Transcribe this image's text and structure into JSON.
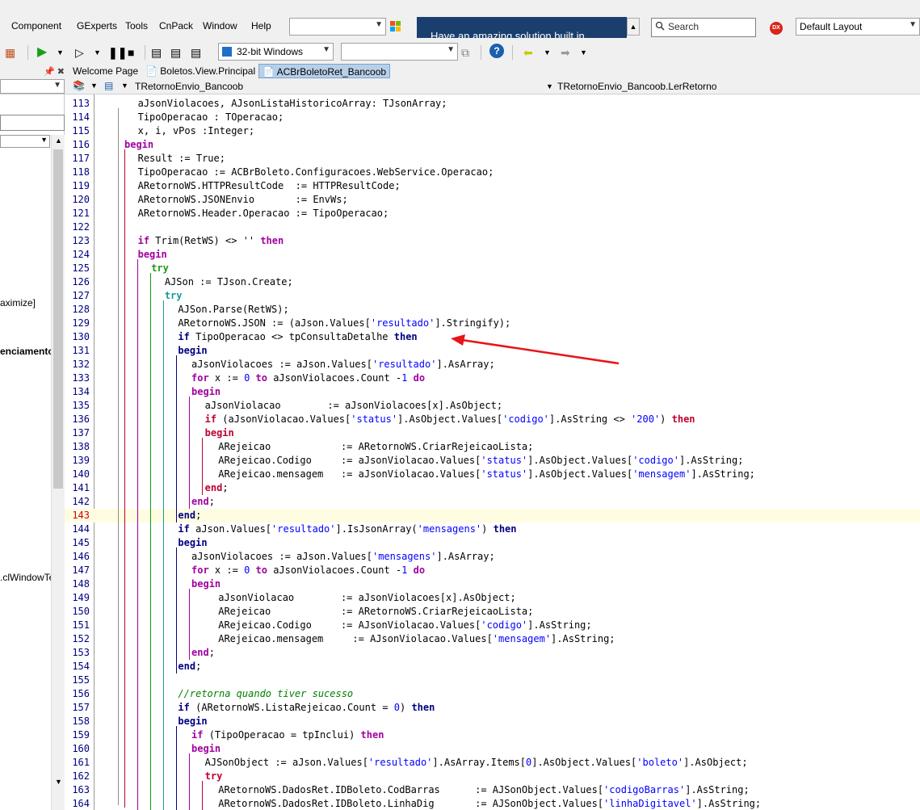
{
  "menu": {
    "items": [
      "Component",
      "GExperts",
      "Tools",
      "CnPack",
      "Window",
      "Help"
    ],
    "search_placeholder": "Search",
    "layout_value": "Default Layout",
    "ad_text": "Have an amazing solution built in",
    "dx_badge": "DX"
  },
  "toolbar": {
    "platform": "32-bit Windows"
  },
  "tabs": [
    {
      "label": "Welcome Page",
      "active": false
    },
    {
      "label": "Boletos.View.Principal",
      "active": false
    },
    {
      "label": "ACBrBoletoRet_Bancoob",
      "active": true
    }
  ],
  "editor": {
    "class_name": "TRetornoEnvio_Bancoob",
    "method_name": "TRetornoEnvio_Bancoob.LerRetorno",
    "current_line": 143
  },
  "left_panel": {
    "items": [
      {
        "text": "aximize]",
        "bold": false
      },
      {
        "text": "enciamento",
        "bold": true
      },
      {
        "text": ".clWindowTe",
        "bold": false
      }
    ]
  },
  "code_lines": [
    {
      "n": "113",
      "indent": 2,
      "parts": [
        [
          "t",
          "aJsonViolacoes, AJsonListaHistoricoArray: TJsonArray;"
        ]
      ]
    },
    {
      "n": "114",
      "indent": 2,
      "parts": [
        [
          "t",
          "TipoOperacao : TOperacao;"
        ]
      ]
    },
    {
      "n": "115",
      "indent": 2,
      "parts": [
        [
          "t",
          "x, i, vPos :Integer;"
        ]
      ]
    },
    {
      "n": "116",
      "indent": 0,
      "parts": [
        [
          "k2",
          "begin"
        ]
      ]
    },
    {
      "n": "117",
      "indent": 2,
      "parts": [
        [
          "t",
          "Result := True;"
        ]
      ]
    },
    {
      "n": "118",
      "indent": 2,
      "parts": [
        [
          "t",
          "TipoOperacao := ACBrBoleto.Configuracoes.WebService.Operacao;"
        ]
      ]
    },
    {
      "n": "119",
      "indent": 2,
      "parts": [
        [
          "t",
          "ARetornoWS.HTTPResultCode  := HTTPResultCode;"
        ]
      ]
    },
    {
      "n": "120",
      "indent": 2,
      "parts": [
        [
          "t",
          "ARetornoWS.JSONEnvio       := EnvWs;"
        ]
      ]
    },
    {
      "n": "121",
      "indent": 2,
      "parts": [
        [
          "t",
          "ARetornoWS.Header.Operacao := TipoOperacao;"
        ]
      ]
    },
    {
      "n": "122",
      "indent": 0,
      "parts": []
    },
    {
      "n": "123",
      "indent": 2,
      "parts": [
        [
          "k2",
          "if"
        ],
        [
          "t",
          " Trim(RetWS) <> '' "
        ],
        [
          "k2",
          "then"
        ]
      ]
    },
    {
      "n": "124",
      "indent": 2,
      "parts": [
        [
          "k2",
          "begin"
        ]
      ]
    },
    {
      "n": "125",
      "indent": 4,
      "parts": [
        [
          "k3",
          "try"
        ]
      ]
    },
    {
      "n": "126",
      "indent": 6,
      "parts": [
        [
          "t",
          "AJSon := TJson.Create;"
        ]
      ]
    },
    {
      "n": "127",
      "indent": 6,
      "parts": [
        [
          "k4",
          "try"
        ]
      ]
    },
    {
      "n": "128",
      "indent": 8,
      "parts": [
        [
          "t",
          "AJSon.Parse(RetWS);"
        ]
      ]
    },
    {
      "n": "129",
      "indent": 8,
      "parts": [
        [
          "t",
          "ARetornoWS.JSON := (aJson.Values["
        ],
        [
          "s",
          "'resultado'"
        ],
        [
          "t",
          "].Stringify);"
        ]
      ]
    },
    {
      "n": "130",
      "indent": 8,
      "parts": [
        [
          "kw",
          "if"
        ],
        [
          "t",
          " TipoOperacao <> tpConsultaDetalhe "
        ],
        [
          "kw",
          "then"
        ]
      ]
    },
    {
      "n": "131",
      "indent": 8,
      "parts": [
        [
          "kw",
          "begin"
        ]
      ]
    },
    {
      "n": "132",
      "indent": 10,
      "parts": [
        [
          "t",
          "aJsonViolacoes := aJson.Values["
        ],
        [
          "s",
          "'resultado'"
        ],
        [
          "t",
          "].AsArray;"
        ]
      ]
    },
    {
      "n": "133",
      "indent": 10,
      "parts": [
        [
          "k2",
          "for"
        ],
        [
          "t",
          " x := "
        ],
        [
          "s",
          "0"
        ],
        [
          "t",
          " "
        ],
        [
          "k2",
          "to"
        ],
        [
          "t",
          " aJsonViolacoes.Count -"
        ],
        [
          "s",
          "1"
        ],
        [
          "t",
          " "
        ],
        [
          "k2",
          "do"
        ]
      ]
    },
    {
      "n": "134",
      "indent": 10,
      "parts": [
        [
          "k2",
          "begin"
        ]
      ]
    },
    {
      "n": "135",
      "indent": 12,
      "parts": [
        [
          "t",
          "aJsonViolacao        := aJsonViolacoes[x].AsObject;"
        ]
      ]
    },
    {
      "n": "136",
      "indent": 12,
      "parts": [
        [
          "k5",
          "if"
        ],
        [
          "t",
          " (aJsonViolacao.Values["
        ],
        [
          "s",
          "'status'"
        ],
        [
          "t",
          "].AsObject.Values["
        ],
        [
          "s",
          "'codigo'"
        ],
        [
          "t",
          "].AsString <> "
        ],
        [
          "s",
          "'200'"
        ],
        [
          "t",
          ") "
        ],
        [
          "k5",
          "then"
        ]
      ]
    },
    {
      "n": "137",
      "indent": 12,
      "parts": [
        [
          "k5",
          "begin"
        ]
      ]
    },
    {
      "n": "138",
      "indent": 14,
      "parts": [
        [
          "t",
          "ARejeicao            := ARetornoWS.CriarRejeicaoLista;"
        ]
      ]
    },
    {
      "n": "139",
      "indent": 14,
      "parts": [
        [
          "t",
          "ARejeicao.Codigo     := aJsonViolacao.Values["
        ],
        [
          "s",
          "'status'"
        ],
        [
          "t",
          "].AsObject.Values["
        ],
        [
          "s",
          "'codigo'"
        ],
        [
          "t",
          "].AsString;"
        ]
      ]
    },
    {
      "n": "140",
      "indent": 14,
      "parts": [
        [
          "t",
          "ARejeicao.mensagem   := aJsonViolacao.Values["
        ],
        [
          "s",
          "'status'"
        ],
        [
          "t",
          "].AsObject.Values["
        ],
        [
          "s",
          "'mensagem'"
        ],
        [
          "t",
          "].AsString;"
        ]
      ]
    },
    {
      "n": "141",
      "indent": 12,
      "parts": [
        [
          "k5",
          "end"
        ],
        [
          "t",
          ";"
        ]
      ]
    },
    {
      "n": "142",
      "indent": 10,
      "parts": [
        [
          "k2",
          "end"
        ],
        [
          "t",
          ";"
        ]
      ]
    },
    {
      "n": "143",
      "indent": 8,
      "parts": [
        [
          "kw",
          "end"
        ],
        [
          "t",
          ";"
        ]
      ]
    },
    {
      "n": "144",
      "indent": 8,
      "parts": [
        [
          "kw",
          "if"
        ],
        [
          "t",
          " aJson.Values["
        ],
        [
          "s",
          "'resultado'"
        ],
        [
          "t",
          "].IsJsonArray("
        ],
        [
          "s",
          "'mensagens'"
        ],
        [
          "t",
          ") "
        ],
        [
          "kw",
          "then"
        ]
      ]
    },
    {
      "n": "145",
      "indent": 8,
      "parts": [
        [
          "kw",
          "begin"
        ]
      ]
    },
    {
      "n": "146",
      "indent": 10,
      "parts": [
        [
          "t",
          "aJsonViolacoes := aJson.Values["
        ],
        [
          "s",
          "'mensagens'"
        ],
        [
          "t",
          "].AsArray;"
        ]
      ]
    },
    {
      "n": "147",
      "indent": 10,
      "parts": [
        [
          "k2",
          "for"
        ],
        [
          "t",
          " x := "
        ],
        [
          "s",
          "0"
        ],
        [
          "t",
          " "
        ],
        [
          "k2",
          "to"
        ],
        [
          "t",
          " aJsonViolacoes.Count -"
        ],
        [
          "s",
          "1"
        ],
        [
          "t",
          " "
        ],
        [
          "k2",
          "do"
        ]
      ]
    },
    {
      "n": "148",
      "indent": 10,
      "parts": [
        [
          "k2",
          "begin"
        ]
      ]
    },
    {
      "n": "149",
      "indent": 14,
      "parts": [
        [
          "t",
          "aJsonViolacao        := aJsonViolacoes[x].AsObject;"
        ]
      ]
    },
    {
      "n": "150",
      "indent": 14,
      "parts": [
        [
          "t",
          "ARejeicao            := ARetornoWS.CriarRejeicaoLista;"
        ]
      ]
    },
    {
      "n": "151",
      "indent": 14,
      "parts": [
        [
          "t",
          "ARejeicao.Codigo     := AJsonViolacao.Values["
        ],
        [
          "s",
          "'codigo'"
        ],
        [
          "t",
          "].AsString;"
        ]
      ]
    },
    {
      "n": "152",
      "indent": 14,
      "parts": [
        [
          "t",
          "ARejeicao.mensagem     := AJsonViolacao.Values["
        ],
        [
          "s",
          "'mensagem'"
        ],
        [
          "t",
          "].AsString;"
        ]
      ]
    },
    {
      "n": "153",
      "indent": 10,
      "parts": [
        [
          "k2",
          "end"
        ],
        [
          "t",
          ";"
        ]
      ]
    },
    {
      "n": "154",
      "indent": 8,
      "parts": [
        [
          "kw",
          "end"
        ],
        [
          "t",
          ";"
        ]
      ]
    },
    {
      "n": "155",
      "indent": 0,
      "parts": []
    },
    {
      "n": "156",
      "indent": 8,
      "parts": [
        [
          "c",
          "//retorna quando tiver sucesso"
        ]
      ]
    },
    {
      "n": "157",
      "indent": 8,
      "parts": [
        [
          "kw",
          "if"
        ],
        [
          "t",
          " (ARetornoWS.ListaRejeicao.Count = "
        ],
        [
          "s",
          "0"
        ],
        [
          "t",
          ") "
        ],
        [
          "kw",
          "then"
        ]
      ]
    },
    {
      "n": "158",
      "indent": 8,
      "parts": [
        [
          "kw",
          "begin"
        ]
      ]
    },
    {
      "n": "159",
      "indent": 10,
      "parts": [
        [
          "k2",
          "if"
        ],
        [
          "t",
          " (TipoOperacao = tpInclui) "
        ],
        [
          "k2",
          "then"
        ]
      ]
    },
    {
      "n": "160",
      "indent": 10,
      "parts": [
        [
          "k2",
          "begin"
        ]
      ]
    },
    {
      "n": "161",
      "indent": 12,
      "parts": [
        [
          "t",
          "AJSonObject := aJson.Values["
        ],
        [
          "s",
          "'resultado'"
        ],
        [
          "t",
          "].AsArray.Items["
        ],
        [
          "s",
          "0"
        ],
        [
          "t",
          "].AsObject.Values["
        ],
        [
          "s",
          "'boleto'"
        ],
        [
          "t",
          "].AsObject;"
        ]
      ]
    },
    {
      "n": "162",
      "indent": 12,
      "parts": [
        [
          "k5",
          "try"
        ]
      ]
    },
    {
      "n": "163",
      "indent": 14,
      "parts": [
        [
          "t",
          "ARetornoWS.DadosRet.IDBoleto.CodBarras      := AJSonObject.Values["
        ],
        [
          "s",
          "'codigoBarras'"
        ],
        [
          "t",
          "].AsString;"
        ]
      ]
    },
    {
      "n": "164",
      "indent": 14,
      "parts": [
        [
          "t",
          "ARetornoWS.DadosRet.IDBoleto.LinhaDig       := AJSonObject.Values["
        ],
        [
          "s",
          "'linhaDigitavel'"
        ],
        [
          "t",
          "].AsString;"
        ]
      ]
    }
  ]
}
